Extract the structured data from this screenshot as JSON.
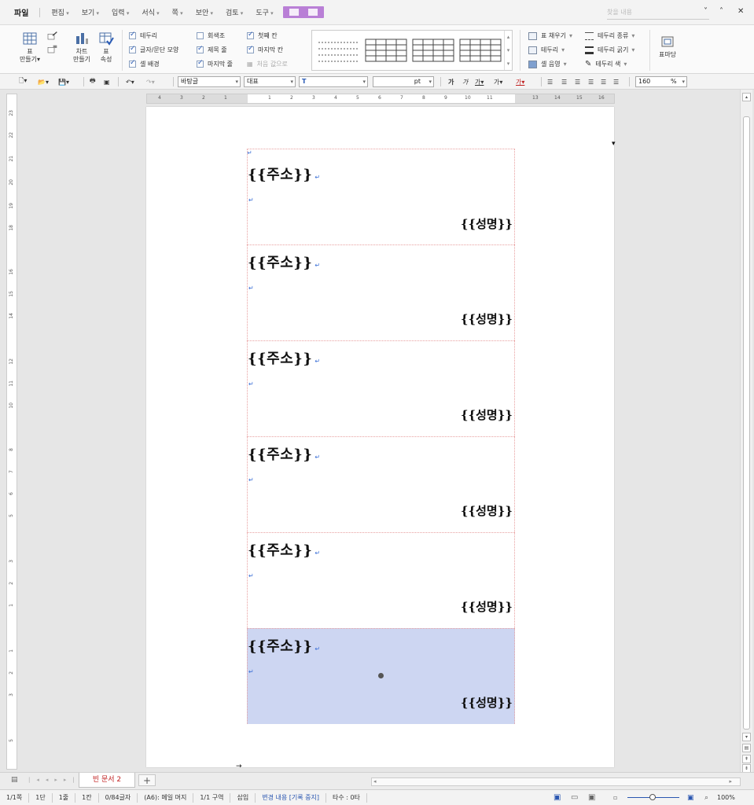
{
  "menu": {
    "file": "파일",
    "items": [
      "편집",
      "보기",
      "입력",
      "서식",
      "쪽",
      "보안",
      "검토",
      "도구"
    ],
    "search_placeholder": "찾을 내용"
  },
  "ribbon": {
    "table_make": "표\n만들기",
    "chart_make": "차트\n만들기",
    "table_props": "표\n속성",
    "checks": [
      {
        "label": "테두리",
        "checked": true
      },
      {
        "label": "글자/문단 모양",
        "checked": true
      },
      {
        "label": "셀 배경",
        "checked": true
      },
      {
        "label": "회색조",
        "checked": false
      },
      {
        "label": "제목 줄",
        "checked": true
      },
      {
        "label": "마지막 줄",
        "checked": true
      },
      {
        "label": "첫째 칸",
        "checked": true
      },
      {
        "label": "마지막 칸",
        "checked": true
      }
    ],
    "reset_default": "처음 값으로",
    "right_tools": [
      "표 채우기",
      "테두리",
      "셀 음영",
      "테두리 종류",
      "테두리 굵기",
      "테두리 색"
    ],
    "table_margin": "표마당"
  },
  "toolbar": {
    "style": "바탕글",
    "lang": "대표",
    "font": "",
    "size_unit": "pt",
    "zoom": "160",
    "zoom_unit": "%"
  },
  "document": {
    "labels": [
      {
        "address": "{{주소}}",
        "name": "{{성명}}"
      },
      {
        "address": "{{주소}}",
        "name": "{{성명}}"
      },
      {
        "address": "{{주소}}",
        "name": "{{성명}}"
      },
      {
        "address": "{{주소}}",
        "name": "{{성명}}"
      },
      {
        "address": "{{주소}}",
        "name": "{{성명}}"
      },
      {
        "address": "{{주소}}",
        "name": "{{성명}}"
      }
    ],
    "return_mark": "↵"
  },
  "tabs": {
    "active": "빈 문서 2",
    "add": "+"
  },
  "status": {
    "page": "1/1쪽",
    "column": "1단",
    "line": "1줄",
    "cell": "1칸",
    "chars": "0/84글자",
    "cell_name": "(A6): 메일 머지",
    "section": "1/1 구역",
    "mode": "삽입",
    "track": "변경 내용 [기록 중지]",
    "typing": "타수 : 0타",
    "zoom": "100%"
  },
  "colors": {
    "selection": "#cdd6f2",
    "label_border": "#e8a0a0",
    "accent_purple": "#b97fd6",
    "tab_text": "#c02020"
  }
}
